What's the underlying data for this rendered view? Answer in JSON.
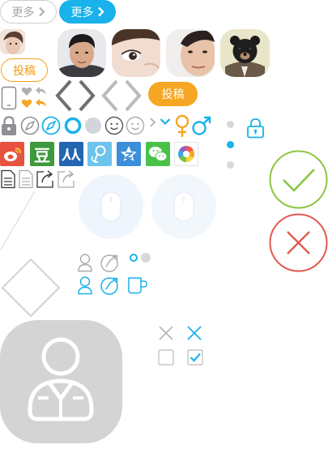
{
  "buttons": {
    "more_inactive": "更多",
    "more_active": "更多",
    "submit_outline": "投稿",
    "submit_filled": "投稿"
  },
  "colors": {
    "accent_blue": "#19b2ea",
    "accent_orange": "#f5a623",
    "check_green": "#8cc63f",
    "cross_red": "#e05a52",
    "gray": "#c8c8c8"
  },
  "icons": [
    "chevron-right-icon",
    "phone-icon",
    "heart-icon",
    "reply-icon",
    "diamond-icon",
    "lock-icon",
    "compass-icon",
    "radio-icon",
    "smile-icon",
    "chevron-down-icon",
    "female-icon",
    "male-icon",
    "weibo-icon",
    "douban-icon",
    "renren-icon",
    "tencent-weibo-icon",
    "qzone-icon",
    "wechat-icon",
    "moments-icon",
    "document-icon",
    "share-icon",
    "mouse-icon",
    "check-icon",
    "close-icon",
    "user-icon",
    "cup-icon",
    "checkbox-icon"
  ],
  "social": {
    "douban_char": "豆"
  }
}
